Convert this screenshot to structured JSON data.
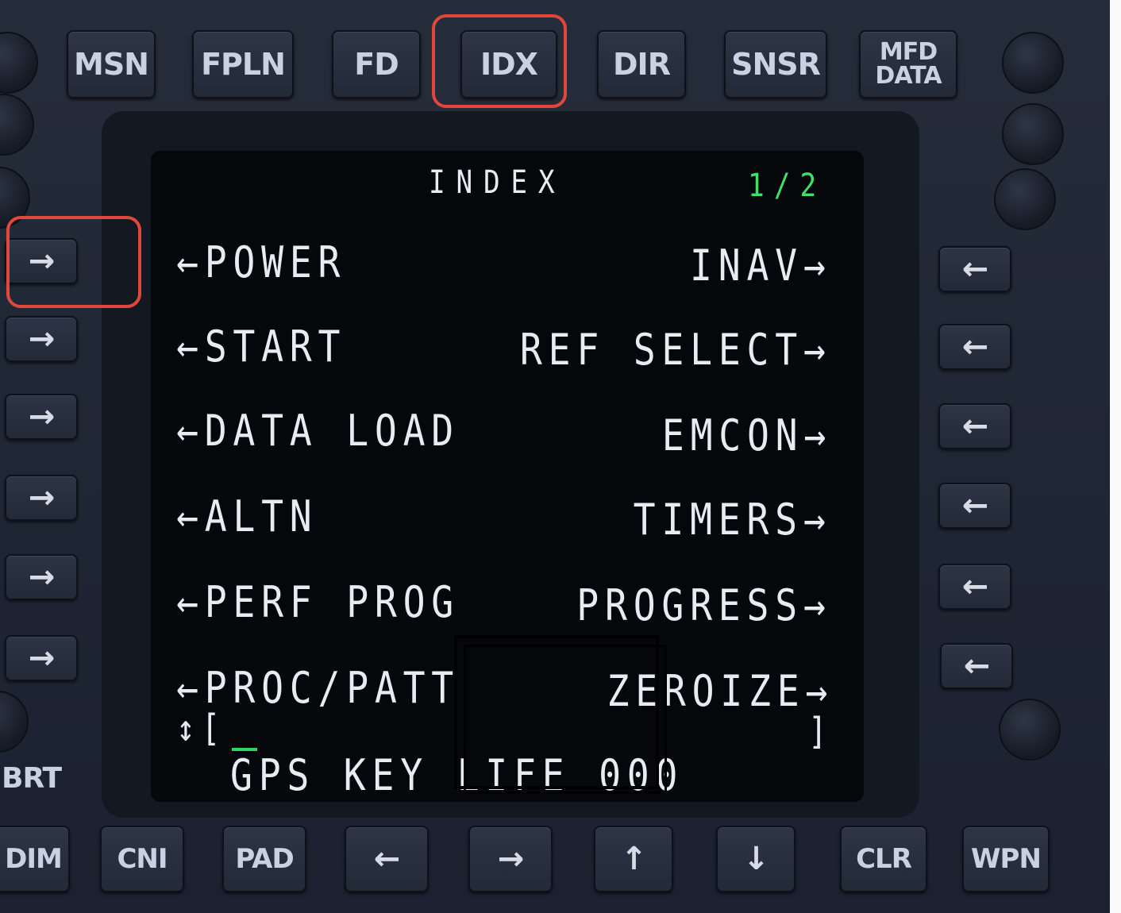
{
  "top_keys": [
    "MSN",
    "FPLN",
    "FD",
    "IDX",
    "DIR",
    "SNSR",
    "MFD DATA"
  ],
  "mfd_lines": [
    "MFD",
    "DATA"
  ],
  "bottom_keys": [
    "CNI",
    "PAD",
    "CLR",
    "WPN"
  ],
  "bottom_arrows": [
    "←",
    "→",
    "↑",
    "↓"
  ],
  "side_labels": {
    "brt": "BRT",
    "dim": "DIM"
  },
  "lsk_left_glyph": "→",
  "lsk_right_glyph": "←",
  "screen": {
    "title": "INDEX",
    "page": "1/2",
    "left": [
      "←POWER",
      "←START",
      "←DATA LOAD",
      "←ALTN",
      "←PERF PROG",
      "←PROC/PATT"
    ],
    "right": [
      "INAV→",
      "REF SELECT→",
      "EMCON→",
      "TIMERS→",
      "PROGRESS→",
      "ZEROIZE→"
    ],
    "scratchpad_open": "↕[",
    "scratchpad_close": "]",
    "status": "GPS KEY LIFE 000"
  },
  "colors": {
    "page_number": "#3fe06a",
    "highlight": "#e2473b",
    "screen_text": "#e8ecf2"
  }
}
